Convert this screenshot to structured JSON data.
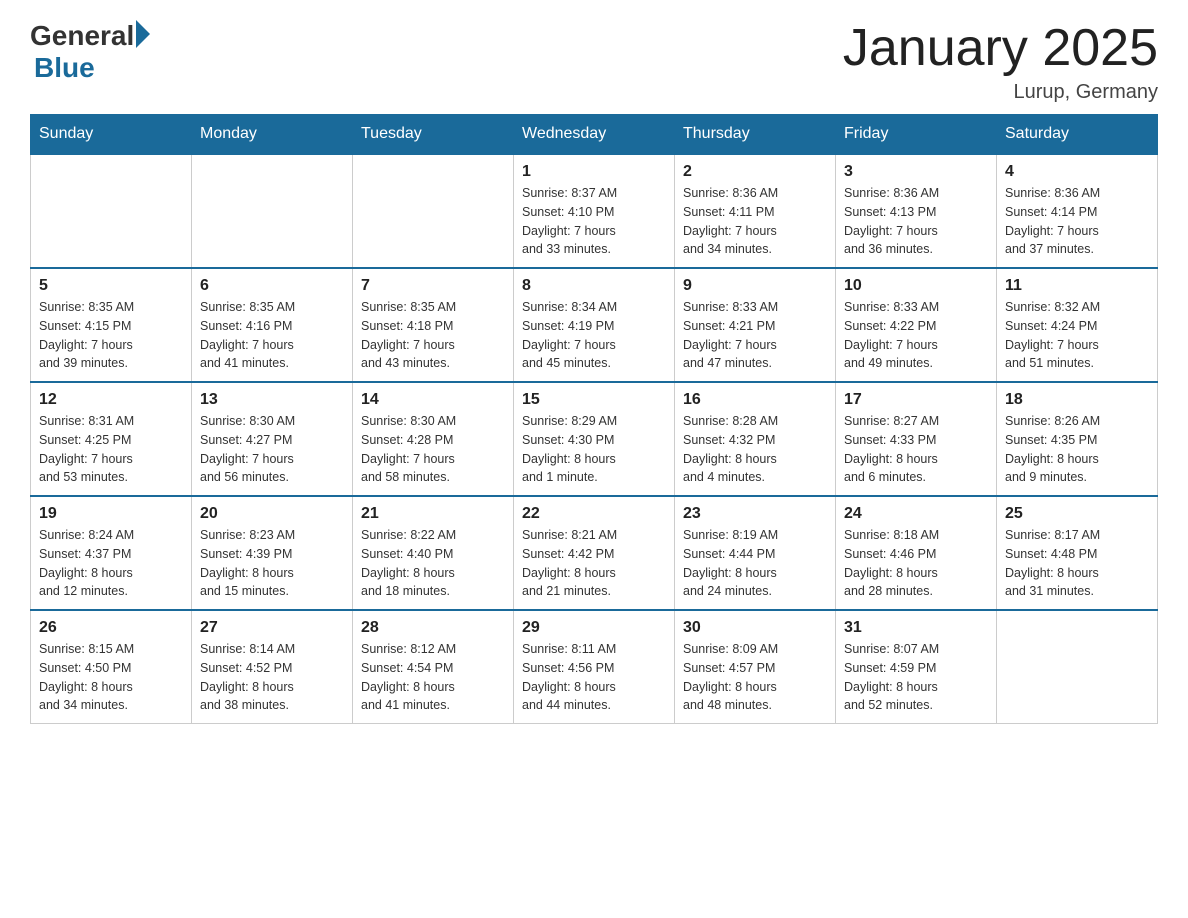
{
  "header": {
    "logo_general": "General",
    "logo_blue": "Blue",
    "title": "January 2025",
    "subtitle": "Lurup, Germany"
  },
  "days_of_week": [
    "Sunday",
    "Monday",
    "Tuesday",
    "Wednesday",
    "Thursday",
    "Friday",
    "Saturday"
  ],
  "weeks": [
    [
      {
        "num": "",
        "info": ""
      },
      {
        "num": "",
        "info": ""
      },
      {
        "num": "",
        "info": ""
      },
      {
        "num": "1",
        "info": "Sunrise: 8:37 AM\nSunset: 4:10 PM\nDaylight: 7 hours\nand 33 minutes."
      },
      {
        "num": "2",
        "info": "Sunrise: 8:36 AM\nSunset: 4:11 PM\nDaylight: 7 hours\nand 34 minutes."
      },
      {
        "num": "3",
        "info": "Sunrise: 8:36 AM\nSunset: 4:13 PM\nDaylight: 7 hours\nand 36 minutes."
      },
      {
        "num": "4",
        "info": "Sunrise: 8:36 AM\nSunset: 4:14 PM\nDaylight: 7 hours\nand 37 minutes."
      }
    ],
    [
      {
        "num": "5",
        "info": "Sunrise: 8:35 AM\nSunset: 4:15 PM\nDaylight: 7 hours\nand 39 minutes."
      },
      {
        "num": "6",
        "info": "Sunrise: 8:35 AM\nSunset: 4:16 PM\nDaylight: 7 hours\nand 41 minutes."
      },
      {
        "num": "7",
        "info": "Sunrise: 8:35 AM\nSunset: 4:18 PM\nDaylight: 7 hours\nand 43 minutes."
      },
      {
        "num": "8",
        "info": "Sunrise: 8:34 AM\nSunset: 4:19 PM\nDaylight: 7 hours\nand 45 minutes."
      },
      {
        "num": "9",
        "info": "Sunrise: 8:33 AM\nSunset: 4:21 PM\nDaylight: 7 hours\nand 47 minutes."
      },
      {
        "num": "10",
        "info": "Sunrise: 8:33 AM\nSunset: 4:22 PM\nDaylight: 7 hours\nand 49 minutes."
      },
      {
        "num": "11",
        "info": "Sunrise: 8:32 AM\nSunset: 4:24 PM\nDaylight: 7 hours\nand 51 minutes."
      }
    ],
    [
      {
        "num": "12",
        "info": "Sunrise: 8:31 AM\nSunset: 4:25 PM\nDaylight: 7 hours\nand 53 minutes."
      },
      {
        "num": "13",
        "info": "Sunrise: 8:30 AM\nSunset: 4:27 PM\nDaylight: 7 hours\nand 56 minutes."
      },
      {
        "num": "14",
        "info": "Sunrise: 8:30 AM\nSunset: 4:28 PM\nDaylight: 7 hours\nand 58 minutes."
      },
      {
        "num": "15",
        "info": "Sunrise: 8:29 AM\nSunset: 4:30 PM\nDaylight: 8 hours\nand 1 minute."
      },
      {
        "num": "16",
        "info": "Sunrise: 8:28 AM\nSunset: 4:32 PM\nDaylight: 8 hours\nand 4 minutes."
      },
      {
        "num": "17",
        "info": "Sunrise: 8:27 AM\nSunset: 4:33 PM\nDaylight: 8 hours\nand 6 minutes."
      },
      {
        "num": "18",
        "info": "Sunrise: 8:26 AM\nSunset: 4:35 PM\nDaylight: 8 hours\nand 9 minutes."
      }
    ],
    [
      {
        "num": "19",
        "info": "Sunrise: 8:24 AM\nSunset: 4:37 PM\nDaylight: 8 hours\nand 12 minutes."
      },
      {
        "num": "20",
        "info": "Sunrise: 8:23 AM\nSunset: 4:39 PM\nDaylight: 8 hours\nand 15 minutes."
      },
      {
        "num": "21",
        "info": "Sunrise: 8:22 AM\nSunset: 4:40 PM\nDaylight: 8 hours\nand 18 minutes."
      },
      {
        "num": "22",
        "info": "Sunrise: 8:21 AM\nSunset: 4:42 PM\nDaylight: 8 hours\nand 21 minutes."
      },
      {
        "num": "23",
        "info": "Sunrise: 8:19 AM\nSunset: 4:44 PM\nDaylight: 8 hours\nand 24 minutes."
      },
      {
        "num": "24",
        "info": "Sunrise: 8:18 AM\nSunset: 4:46 PM\nDaylight: 8 hours\nand 28 minutes."
      },
      {
        "num": "25",
        "info": "Sunrise: 8:17 AM\nSunset: 4:48 PM\nDaylight: 8 hours\nand 31 minutes."
      }
    ],
    [
      {
        "num": "26",
        "info": "Sunrise: 8:15 AM\nSunset: 4:50 PM\nDaylight: 8 hours\nand 34 minutes."
      },
      {
        "num": "27",
        "info": "Sunrise: 8:14 AM\nSunset: 4:52 PM\nDaylight: 8 hours\nand 38 minutes."
      },
      {
        "num": "28",
        "info": "Sunrise: 8:12 AM\nSunset: 4:54 PM\nDaylight: 8 hours\nand 41 minutes."
      },
      {
        "num": "29",
        "info": "Sunrise: 8:11 AM\nSunset: 4:56 PM\nDaylight: 8 hours\nand 44 minutes."
      },
      {
        "num": "30",
        "info": "Sunrise: 8:09 AM\nSunset: 4:57 PM\nDaylight: 8 hours\nand 48 minutes."
      },
      {
        "num": "31",
        "info": "Sunrise: 8:07 AM\nSunset: 4:59 PM\nDaylight: 8 hours\nand 52 minutes."
      },
      {
        "num": "",
        "info": ""
      }
    ]
  ]
}
